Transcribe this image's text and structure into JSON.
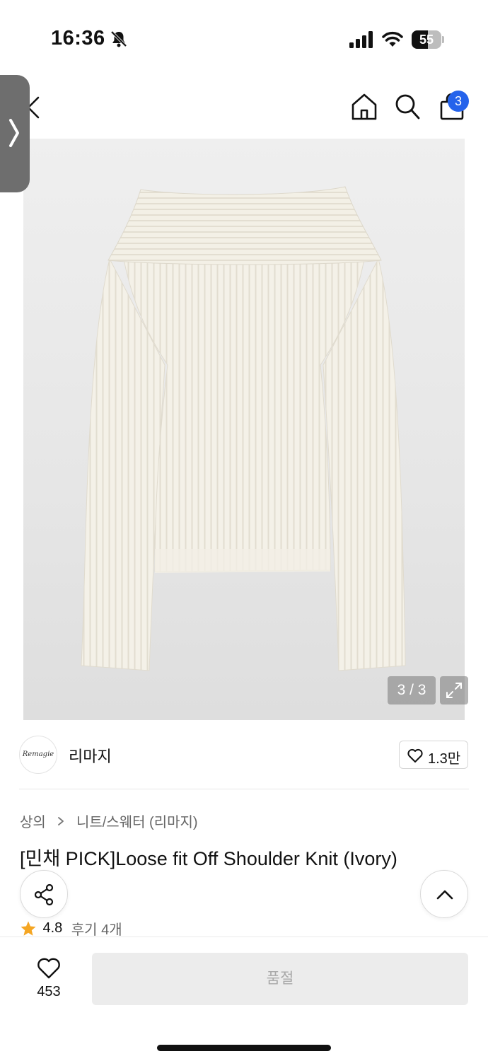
{
  "status_bar": {
    "time": "16:36",
    "battery_level": "55",
    "battery_fraction": 0.55
  },
  "top_nav": {
    "cart_count": "3"
  },
  "gallery": {
    "counter": "3 / 3"
  },
  "brand": {
    "logo_text": "Remagie",
    "name": "리마지",
    "like_count": "1.3만"
  },
  "product": {
    "breadcrumb": [
      "상의",
      "니트/스웨터 (리마지)"
    ],
    "title": "[민채 PICK]Loose fit Off Shoulder Knit (Ivory)",
    "rating": "4.8",
    "review_link": "후기 4개"
  },
  "bottom_bar": {
    "wish_count": "453",
    "soldout_label": "품절"
  },
  "colors": {
    "badge": "#2563eb",
    "star": "#f5a623",
    "soldout_bg": "#ececec",
    "soldout_text": "#a9a9a9"
  }
}
